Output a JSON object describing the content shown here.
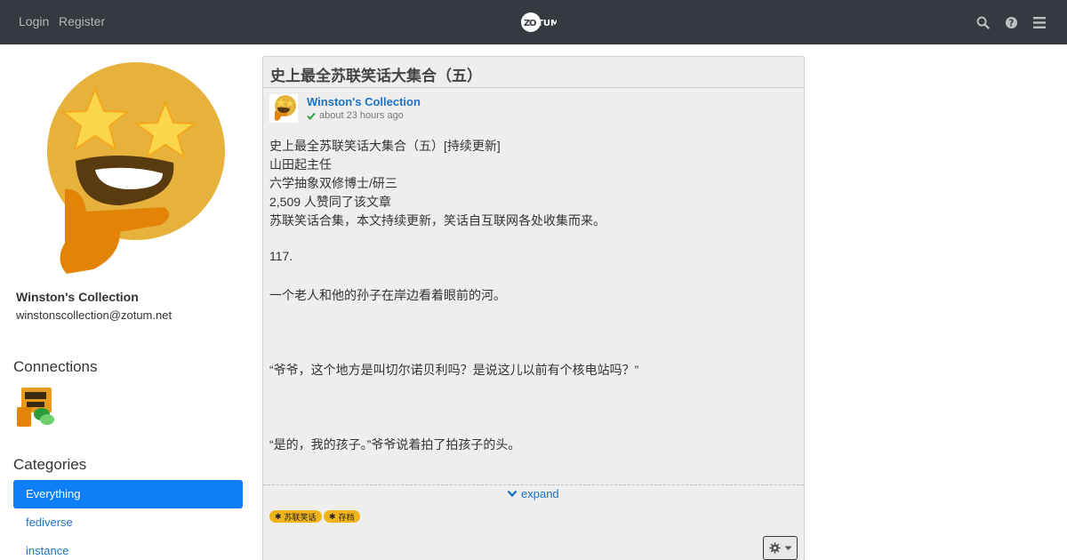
{
  "navbar": {
    "login": "Login",
    "register": "Register",
    "brand": "ZOTUM",
    "icons": [
      "search-icon",
      "help-icon",
      "menu-icon"
    ]
  },
  "profile": {
    "name": "Winston's Collection",
    "address": "winstonscollection@zotum.net"
  },
  "sidebar": {
    "connections_title": "Connections",
    "categories_title": "Categories",
    "categories": [
      "Everything",
      "fediverse",
      "instance"
    ]
  },
  "post": {
    "title": "史上最全苏联笑话大集合（五）",
    "author": "Winston's Collection",
    "time": "about 23 hours ago",
    "lines": [
      "史上最全苏联笑话大集合（五）[持续更新]",
      "山田起主任",
      "六学抽象双修博士/研三",
      "2,509 人赞同了该文章",
      "苏联笑话合集，本文持续更新，笑话自互联网各处收集而来。",
      "117.",
      "一个老人和他的孙子在岸边看着眼前的河。",
      "“爷爷，这个地方是叫切尔诺贝利吗？是说这儿以前有个核电站吗？”",
      "“是的，我的孩子。”爷爷说着拍了拍孩子的头。"
    ],
    "expand_label": "expand",
    "tags": [
      "苏联笑话",
      "存档"
    ]
  },
  "colors": {
    "navbar_bg": "#343a40",
    "accent": "#0d7ef7",
    "link": "#1a73c8",
    "tag_bg": "#f0b41b",
    "card_bg": "#eeeeee"
  }
}
